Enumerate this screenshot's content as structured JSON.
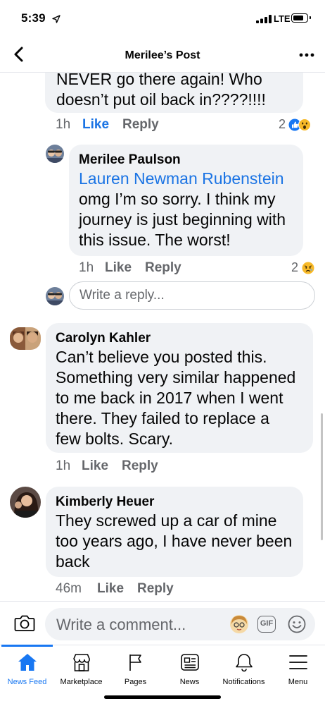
{
  "status": {
    "time": "5:39",
    "carrier": "LTE"
  },
  "header": {
    "title": "Merilee’s Post"
  },
  "comments": [
    {
      "text_lines": [
        "NEVER go there again! Who",
        "doesn’t put oil back in????!!!!"
      ],
      "time": "1h",
      "like": "Like",
      "reply": "Reply",
      "reaction_count": "2"
    },
    {
      "name": "Merilee Paulson",
      "mention": "Lauren Newman Rubenstein",
      "text_lines": [
        "omg I’m so sorry. I think my",
        "journey is just beginning with",
        "this issue. The worst!"
      ],
      "time": "1h",
      "like": "Like",
      "reply": "Reply",
      "reaction_count": "2"
    },
    {
      "name": "Carolyn Kahler",
      "text_lines": [
        "Can’t believe you posted this.",
        "Something very similar happened",
        "to me back in 2017 when I went",
        "there.  They failed to replace a",
        "few bolts. Scary."
      ],
      "time": "1h",
      "like": "Like",
      "reply": "Reply"
    },
    {
      "name": "Kimberly Heuer",
      "text_lines": [
        "They screwed up a car of mine",
        "too years ago, I have never been",
        "back"
      ],
      "time": "46m",
      "like": "Like",
      "reply": "Reply"
    }
  ],
  "reply_input": {
    "placeholder": "Write a reply..."
  },
  "composer": {
    "placeholder": "Write a comment...",
    "gif_label": "GIF"
  },
  "tabs": [
    {
      "label": "News Feed",
      "icon": "home-icon",
      "active": true
    },
    {
      "label": "Marketplace",
      "icon": "marketplace-icon"
    },
    {
      "label": "Pages",
      "icon": "flag-icon"
    },
    {
      "label": "News",
      "icon": "news-icon"
    },
    {
      "label": "Notifications",
      "icon": "bell-icon"
    },
    {
      "label": "Menu",
      "icon": "menu-icon"
    }
  ],
  "colors": {
    "accent": "#1877f2",
    "bubble": "#f0f2f5",
    "secondary_text": "#65676b"
  }
}
